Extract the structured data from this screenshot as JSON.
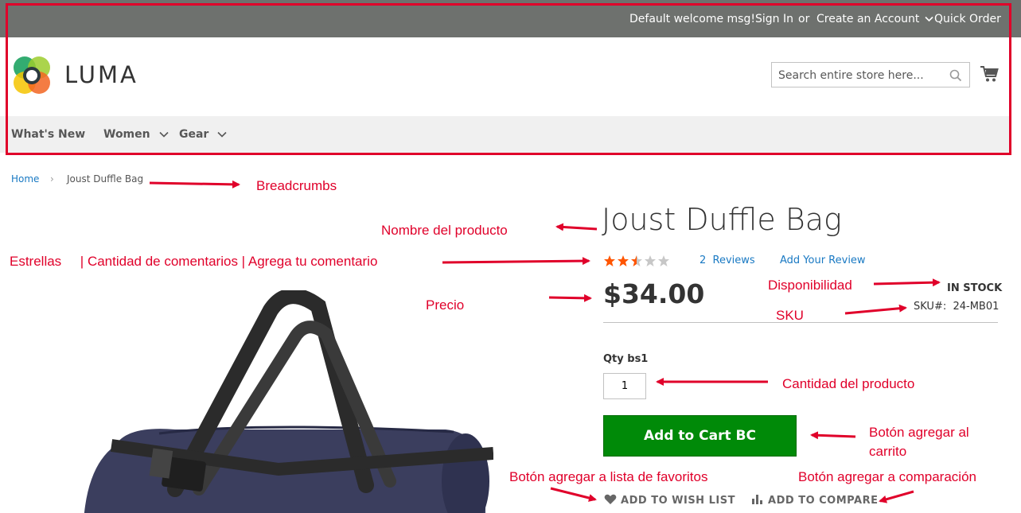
{
  "header": {
    "welcome": "Default welcome msg!",
    "sign_in": "Sign In",
    "or": "or",
    "create_account": "Create an Account",
    "quick_order": "Quick Order",
    "logo_text": "LUMA",
    "search_placeholder": "Search entire store here..."
  },
  "nav": {
    "items": [
      "What's New",
      "Women",
      "Gear"
    ]
  },
  "breadcrumb": {
    "home": "Home",
    "separator": "›",
    "current": "Joust Duffle Bag"
  },
  "product": {
    "name": "Joust Duffle Bag",
    "rating_stars": 2.5,
    "reviews_count_label": "2",
    "reviews_label": "Reviews",
    "add_review": "Add Your Review",
    "price": "$34.00",
    "stock": "IN STOCK",
    "sku_label": "SKU#:",
    "sku_value": "24-MB01",
    "qty_label": "Qty bs1",
    "qty_value": "1",
    "add_to_cart": "Add to Cart BC",
    "wishlist": "ADD TO WISH LIST",
    "compare": "ADD TO COMPARE"
  },
  "annotations": {
    "breadcrumbs": "Breadcrumbs",
    "product_name": "Nombre del producto",
    "stars_line": "Estrellas     | Cantidad de comentarios | Agrega tu comentario",
    "availability": "Disponibilidad",
    "price": "Precio",
    "sku": "SKU",
    "qty": "Cantidad del producto",
    "cart_btn_line1": "Botón agregar al",
    "cart_btn_line2": "carrito",
    "wishlist": "Botón agregar a lista de favoritos",
    "compare": "Botón agregar a comparación"
  },
  "colors": {
    "topbar": "#6e716e",
    "accent_red": "#e0002a",
    "link_blue": "#1979c3",
    "cart_green": "#008a08",
    "star_orange": "#ff5501"
  }
}
